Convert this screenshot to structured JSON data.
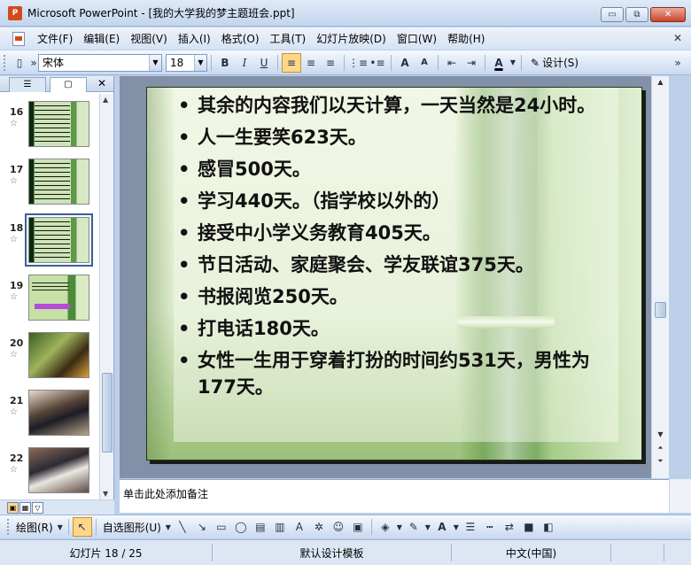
{
  "window": {
    "app_badge": "P",
    "title": "Microsoft PowerPoint - [我的大学我的梦主题班会.ppt]",
    "minimize": "▭",
    "restore": "⧉",
    "close": "✕"
  },
  "menu": {
    "items": [
      "文件(F)",
      "编辑(E)",
      "视图(V)",
      "插入(I)",
      "格式(O)",
      "工具(T)",
      "幻灯片放映(D)",
      "窗口(W)",
      "帮助(H)"
    ],
    "close": "✕"
  },
  "toolbar": {
    "font_name": "宋体",
    "font_size": "18",
    "bold": "B",
    "italic": "I",
    "underline": "U",
    "increase_font": "A",
    "decrease_font": "A",
    "font_color": "A",
    "design_label": "设计(S)"
  },
  "left_pane": {
    "tab_outline": "☰",
    "tab_slides": "▢",
    "close": "✕",
    "star": "☆",
    "thumbnails": [
      {
        "num": "16"
      },
      {
        "num": "17"
      },
      {
        "num": "18"
      },
      {
        "num": "19"
      },
      {
        "num": "20"
      },
      {
        "num": "21"
      },
      {
        "num": "22"
      }
    ],
    "selected": "18"
  },
  "slide": {
    "bullets": [
      "其余的内容我们以天计算，一天当然是24小时。",
      "人一生要笑623天。",
      "感冒500天。",
      " 学习440天。（指学校以外的）",
      "接受中小学义务教育405天。",
      "节日活动、家庭聚会、学友联谊375天。",
      "书报阅览250天。",
      "打电话180天。",
      "女性一生用于穿着打扮的时间约531天，男性为177天。"
    ]
  },
  "notes": {
    "placeholder": "单击此处添加备注"
  },
  "drawing": {
    "draw_label": "绘图(R)",
    "autoshape_label": "自选图形(U)"
  },
  "status": {
    "slide_info": "幻灯片 18 / 25",
    "template": "默认设计模板",
    "language": "中文(中国)"
  }
}
